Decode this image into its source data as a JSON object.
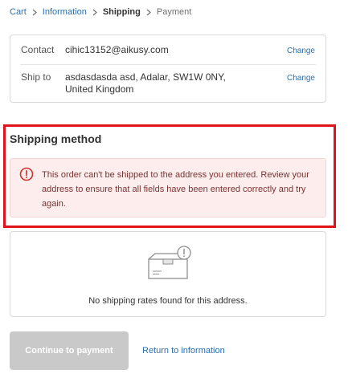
{
  "breadcrumb": {
    "items": [
      {
        "label": "Cart"
      },
      {
        "label": "Information"
      },
      {
        "label": "Shipping"
      },
      {
        "label": "Payment"
      }
    ]
  },
  "review": {
    "contact": {
      "label": "Contact",
      "value": "cihic13152@aikusy.com",
      "change": "Change"
    },
    "ship_to": {
      "label": "Ship to",
      "value": "asdasdasda asd, Adalar, SW1W 0NY, United Kingdom",
      "change": "Change"
    }
  },
  "shipping": {
    "title": "Shipping method",
    "error_message": "This order can't be shipped to the address you entered. Review your address to ensure that all fields have been entered correctly and try again.",
    "no_rates_message": "No shipping rates found for this address."
  },
  "actions": {
    "continue_label": "Continue to payment",
    "return_label": "Return to information"
  },
  "colors": {
    "link": "#2a6fb0",
    "highlight_border": "#e0131a",
    "error_background": "#fdeded",
    "error_icon": "#d0312d",
    "disabled_button": "#c9c9c9"
  },
  "icons": [
    "chevron-right-icon",
    "error-icon",
    "box-alert-icon"
  ]
}
